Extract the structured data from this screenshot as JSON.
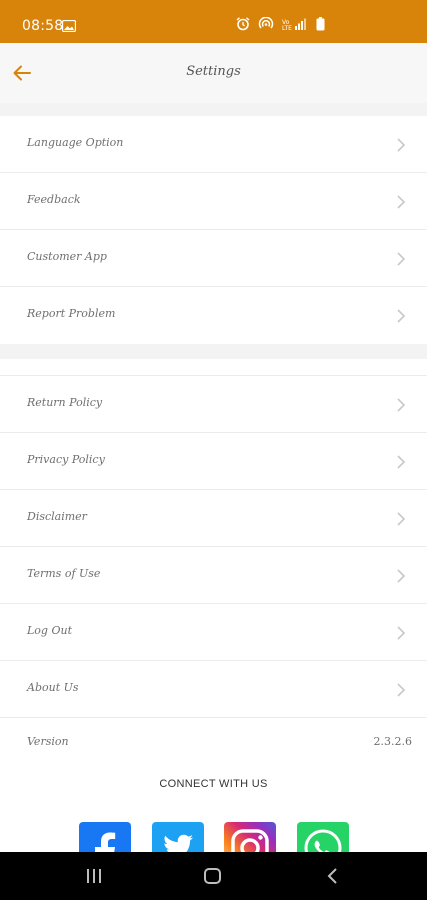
{
  "status_bar": {
    "time": "08:58",
    "icons": [
      "image-icon",
      "alarm-icon",
      "hotspot-icon",
      "signal-icon",
      "battery-icon"
    ],
    "background": "#D8840B"
  },
  "header": {
    "title": "Settings",
    "back_icon": "back-arrow-icon",
    "accent_color": "#D8840B"
  },
  "settings_group_1": [
    {
      "label": "Language Option"
    },
    {
      "label": "Feedback"
    },
    {
      "label": "Customer App"
    },
    {
      "label": "Report Problem"
    }
  ],
  "settings_group_2": [
    {
      "label": "Return Policy"
    },
    {
      "label": "Privacy Policy"
    },
    {
      "label": "Disclaimer"
    },
    {
      "label": "Terms of Use"
    },
    {
      "label": "Log Out"
    },
    {
      "label": "About Us"
    }
  ],
  "version": {
    "label": "Version",
    "value": "2.3.2.6"
  },
  "connect": {
    "title": "CONNECT WITH US",
    "networks": [
      {
        "name": "facebook-icon",
        "color": "#1877F2"
      },
      {
        "name": "twitter-icon",
        "color": "#1DA1F2"
      },
      {
        "name": "instagram-icon",
        "color": "#C13584"
      },
      {
        "name": "whatsapp-icon",
        "color": "#25D366"
      }
    ]
  },
  "nav_bar": {
    "buttons": [
      "recent-apps-icon",
      "home-icon",
      "back-icon"
    ]
  }
}
